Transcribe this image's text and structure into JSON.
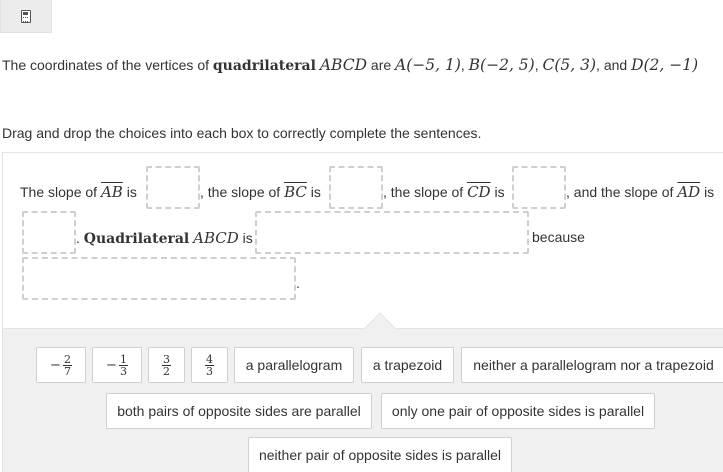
{
  "toolbar": {
    "calculator_icon": "calculator-icon"
  },
  "question": {
    "prefix": "The coordinates of the vertices of",
    "quad_word": "quadrilateral",
    "quad_name": "ABCD",
    "are": "are",
    "vA": "A(−5, 1)",
    "vB": "B(−2, 5)",
    "vC": "C(5, 3)",
    "and": "and",
    "vD": "D(2,  −1)"
  },
  "instruction": "Drag and drop the choices into each box to correctly complete the sentences.",
  "sentence": {
    "the_slope_of": "The slope of",
    "seg_ab": "AB",
    "is": "is",
    "comma_the_slope_of": ", the slope of",
    "seg_bc": "BC",
    "seg_cd": "CD",
    "comma_and_the_slope_of": ", and the slope of",
    "seg_ad": "AD",
    "period": ".",
    "quad_word": "Quadrilateral",
    "quad_name": "ABCD",
    "because": "because",
    "end_period": "."
  },
  "choices": {
    "frac1": {
      "sign": "−",
      "num": "2",
      "den": "7"
    },
    "frac2": {
      "sign": "−",
      "num": "1",
      "den": "3"
    },
    "frac3": {
      "num": "3",
      "den": "2"
    },
    "frac4": {
      "num": "4",
      "den": "3"
    },
    "parallelogram": "a parallelogram",
    "trapezoid": "a trapezoid",
    "neither_shape": "neither a parallelogram nor a trapezoid",
    "both_pairs": "both pairs of opposite sides are parallel",
    "one_pair": "only one pair of opposite sides is parallel",
    "neither_pair": "neither pair of opposite sides is parallel"
  }
}
